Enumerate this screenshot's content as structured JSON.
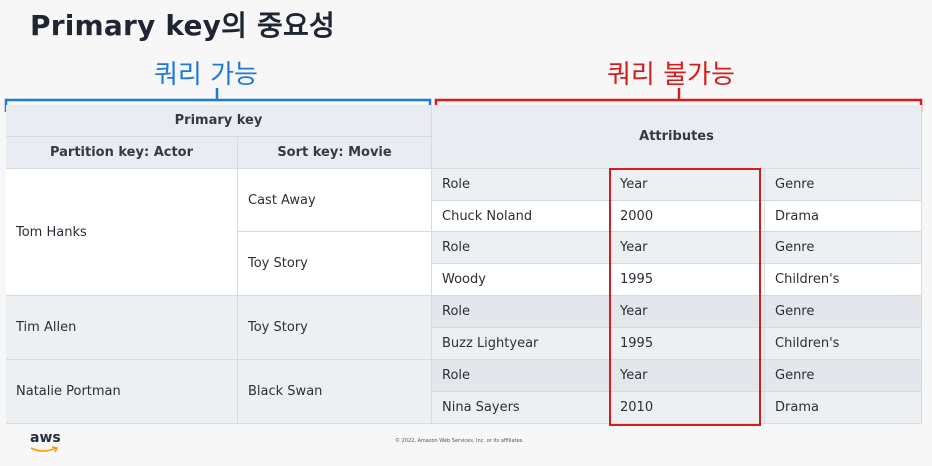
{
  "title": "Primary key의 중요성",
  "labels": {
    "queryable": "쿼리 가능",
    "not_queryable": "쿼리 불가능"
  },
  "table": {
    "primary_key_header": "Primary key",
    "partition_key_header": "Partition key: Actor",
    "sort_key_header": "Sort key: Movie",
    "attributes_header": "Attributes",
    "actors": [
      "Tom Hanks",
      "Tim Allen",
      "Natalie Portman"
    ],
    "movies": [
      "Cast Away",
      "Toy Story",
      "Toy Story",
      "Black Swan"
    ],
    "attribute_rows": [
      [
        "Role",
        "Year",
        "Genre"
      ],
      [
        "Chuck Noland",
        "2000",
        "Drama"
      ],
      [
        "Role",
        "Year",
        "Genre"
      ],
      [
        "Woody",
        "1995",
        "Children's"
      ],
      [
        "Role",
        "Year",
        "Genre"
      ],
      [
        "Buzz Lightyear",
        "1995",
        "Children's"
      ],
      [
        "Role",
        "Year",
        "Genre"
      ],
      [
        "Nina Sayers",
        "2010",
        "Drama"
      ]
    ]
  },
  "footer": {
    "logo_text": "aws",
    "copyright": "© 2022, Amazon Web Services, Inc. or its affiliates."
  },
  "colors": {
    "blue": "#1e7ad6",
    "red": "#d61d1d"
  }
}
